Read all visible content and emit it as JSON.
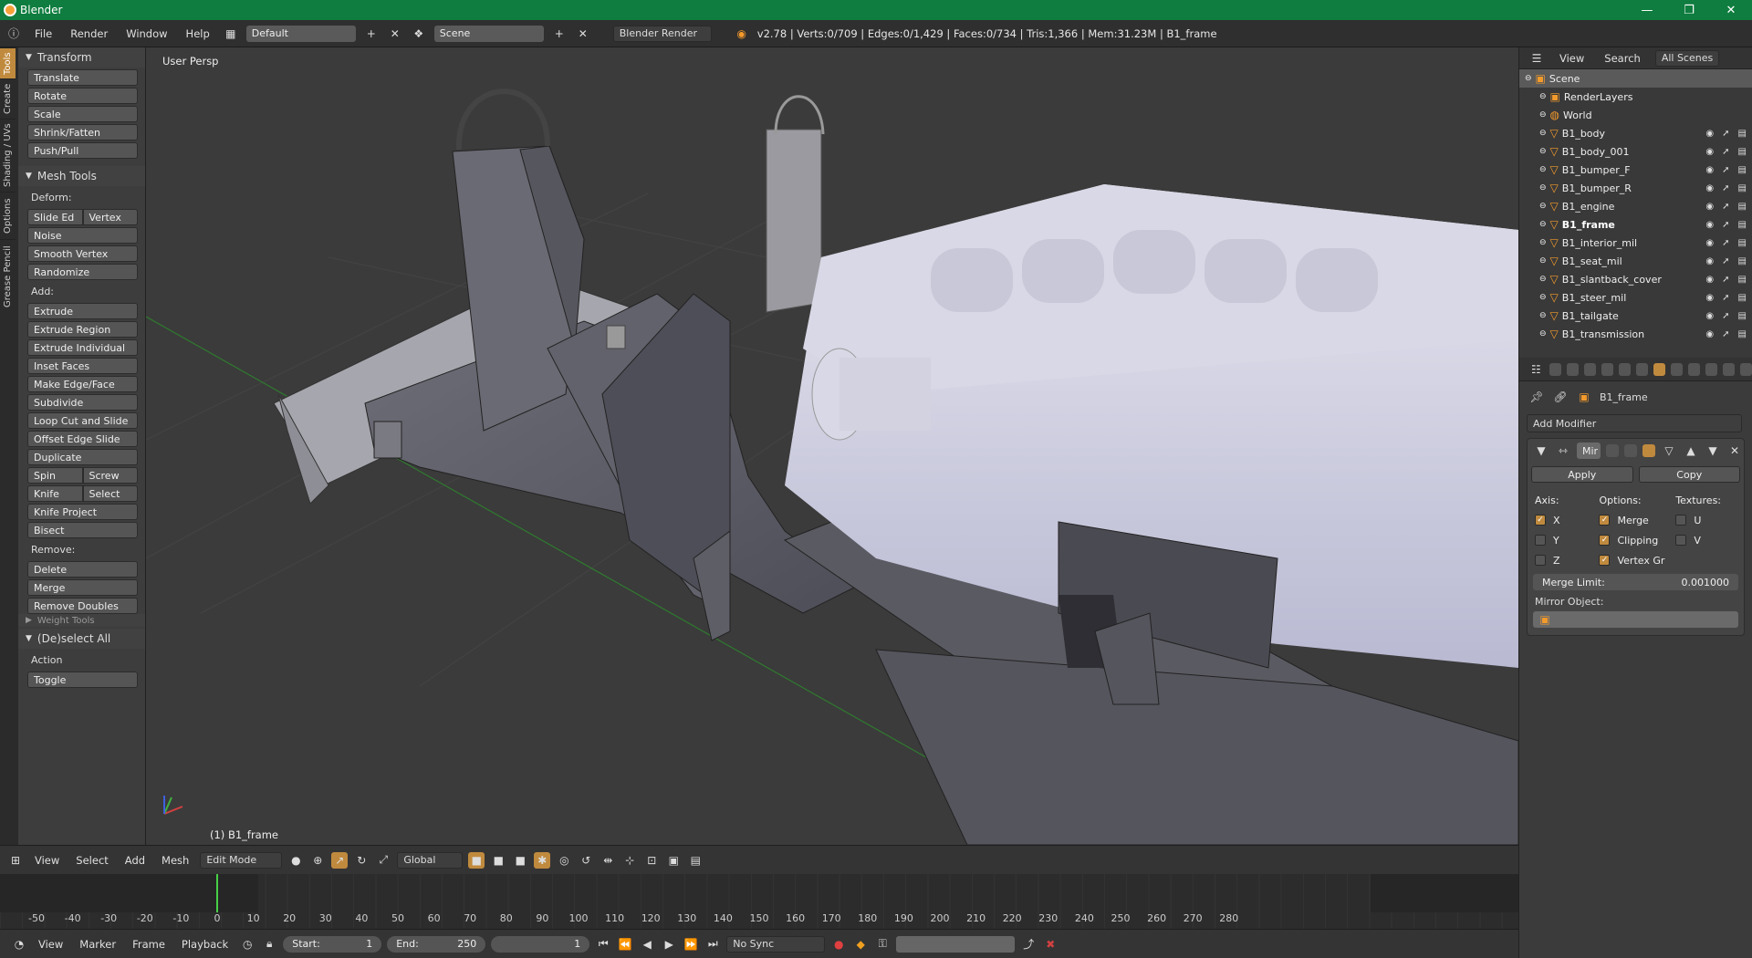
{
  "window": {
    "title": "Blender",
    "controls": [
      "—",
      "❐",
      "✕"
    ]
  },
  "infobar": {
    "menus": [
      "File",
      "Render",
      "Window",
      "Help"
    ],
    "screen_layout": "Default",
    "scene": "Scene",
    "engine": "Blender Render",
    "stats": "v2.78 | Verts:0/709 | Edges:0/1,429 | Faces:0/734 | Tris:1,366 | Mem:31.23M | B1_frame"
  },
  "tabs": [
    "Tools",
    "Create",
    "Shading / UVs",
    "Options",
    "Grease Pencil"
  ],
  "toolshelf": {
    "transform": {
      "title": "Transform",
      "buttons": [
        "Translate",
        "Rotate",
        "Scale",
        "Shrink/Fatten",
        "Push/Pull"
      ]
    },
    "mesh_tools": {
      "title": "Mesh Tools",
      "deform_label": "Deform:",
      "slide_edge": "Slide Ed",
      "vertex": "Vertex",
      "deform_buttons": [
        "Noise",
        "Smooth Vertex",
        "Randomize"
      ],
      "add_label": "Add:",
      "add_buttons": [
        "Extrude",
        "Extrude Region",
        "Extrude Individual",
        "Inset Faces",
        "Make Edge/Face",
        "Subdivide",
        "Loop Cut and Slide",
        "Offset Edge Slide",
        "Duplicate"
      ],
      "spin": "Spin",
      "screw": "Screw",
      "knife": "Knife",
      "select": "Select",
      "knife_project": "Knife Project",
      "bisect": "Bisect",
      "remove_label": "Remove:",
      "delete": "Delete",
      "merge": "Merge",
      "remove_doubles": "Remove Doubles",
      "weight_tools": "Weight Tools"
    },
    "deselect": {
      "title": "(De)select All",
      "action_label": "Action",
      "action_value": "Toggle"
    }
  },
  "viewport": {
    "label": "User Persp",
    "object": "(1) B1_frame"
  },
  "viewport_header": {
    "menus": [
      "View",
      "Select",
      "Add",
      "Mesh"
    ],
    "mode": "Edit Mode",
    "orientation": "Global"
  },
  "timeline": {
    "ticks": [
      "-50",
      "-40",
      "-30",
      "-20",
      "-10",
      "0",
      "10",
      "20",
      "30",
      "40",
      "50",
      "60",
      "70",
      "80",
      "90",
      "100",
      "110",
      "120",
      "130",
      "140",
      "150",
      "160",
      "170",
      "180",
      "190",
      "200",
      "210",
      "220",
      "230",
      "240",
      "250",
      "260",
      "270",
      "280"
    ],
    "current_frame_value": 0
  },
  "time_footer": {
    "menus": [
      "View",
      "Marker",
      "Frame",
      "Playback"
    ],
    "start": "Start:",
    "start_val": "1",
    "end": "End:",
    "end_val": "250",
    "current": "1",
    "sync": "No Sync"
  },
  "outliner": {
    "tabs": [
      "View",
      "Search",
      "All Scenes"
    ],
    "items": [
      {
        "label": "Scene",
        "kind": "scene",
        "level": 0
      },
      {
        "label": "RenderLayers",
        "kind": "layers",
        "level": 1
      },
      {
        "label": "World",
        "kind": "world",
        "level": 1
      },
      {
        "label": "B1_body",
        "kind": "mesh",
        "level": 1
      },
      {
        "label": "B1_body_001",
        "kind": "mesh",
        "level": 1
      },
      {
        "label": "B1_bumper_F",
        "kind": "mesh",
        "level": 1
      },
      {
        "label": "B1_bumper_R",
        "kind": "mesh",
        "level": 1
      },
      {
        "label": "B1_engine",
        "kind": "mesh",
        "level": 1
      },
      {
        "label": "B1_frame",
        "kind": "mesh",
        "level": 1,
        "active": true
      },
      {
        "label": "B1_interior_mil",
        "kind": "mesh",
        "level": 1
      },
      {
        "label": "B1_seat_mil",
        "kind": "mesh",
        "level": 1
      },
      {
        "label": "B1_slantback_cover",
        "kind": "mesh",
        "level": 1
      },
      {
        "label": "B1_steer_mil",
        "kind": "mesh",
        "level": 1
      },
      {
        "label": "B1_tailgate",
        "kind": "mesh",
        "level": 1
      },
      {
        "label": "B1_transmission",
        "kind": "mesh",
        "level": 1
      }
    ]
  },
  "properties": {
    "object": "B1_frame",
    "add_modifier": "Add Modifier",
    "modifier_name": "Mir",
    "apply": "Apply",
    "copy": "Copy",
    "axis_label": "Axis:",
    "options_label": "Options:",
    "textures_label": "Textures:",
    "axes": [
      {
        "label": "X",
        "on": true
      },
      {
        "label": "Y",
        "on": false
      },
      {
        "label": "Z",
        "on": false
      }
    ],
    "options": [
      {
        "label": "Merge",
        "on": true
      },
      {
        "label": "Clipping",
        "on": true
      },
      {
        "label": "Vertex Gr",
        "on": true
      }
    ],
    "textures": [
      {
        "label": "U",
        "on": false
      },
      {
        "label": "V",
        "on": false
      }
    ],
    "merge_limit_label": "Merge Limit:",
    "merge_limit_value": "0.001000",
    "mirror_object_label": "Mirror Object:"
  },
  "colors": {
    "title_bar": "#0e7d3f",
    "active_tab": "#c08a3e",
    "viewport_bg": "#3b3b3b",
    "mesh_light": "#d8d8e8",
    "mesh_dark": "#5c5c66",
    "grid_green": "#2f7a2f"
  }
}
